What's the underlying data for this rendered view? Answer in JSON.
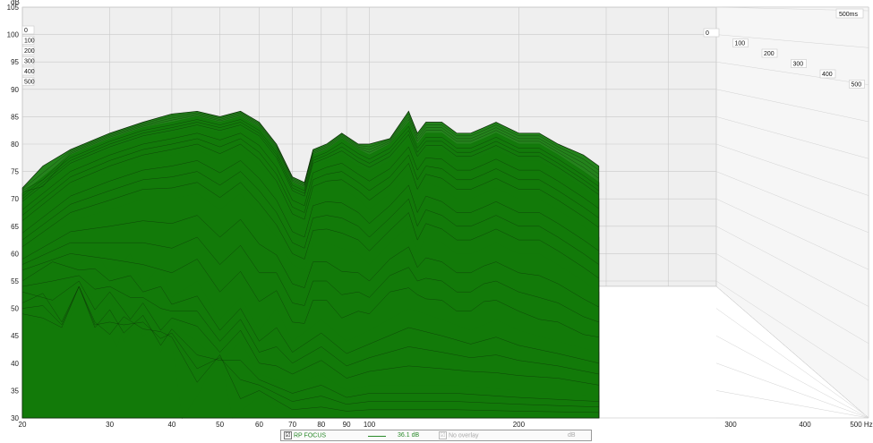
{
  "chart_data": {
    "type": "area",
    "chart_kind": "waterfall",
    "xlabel": "Hz",
    "ylabel": "dB",
    "x_scale": "log",
    "xlim": [
      20,
      500
    ],
    "ylim": [
      30,
      105
    ],
    "x_ticks": [
      "20",
      "30",
      "40",
      "50",
      "60",
      "70",
      "80",
      "90",
      "100",
      "200",
      "300",
      "400",
      "500 Hz"
    ],
    "x_tick_values": [
      20,
      30,
      40,
      50,
      60,
      70,
      80,
      90,
      100,
      200,
      300,
      400,
      500
    ],
    "y_ticks": [
      "30",
      "35",
      "40",
      "45",
      "50",
      "55",
      "60",
      "65",
      "70",
      "75",
      "80",
      "85",
      "90",
      "95",
      "100",
      "105"
    ],
    "y_tick_values": [
      30,
      35,
      40,
      45,
      50,
      55,
      60,
      65,
      70,
      75,
      80,
      85,
      90,
      95,
      100,
      105
    ],
    "time_ticks_left": [
      "0",
      "100",
      "200",
      "300",
      "400",
      "500"
    ],
    "time_ticks_right": [
      "0",
      "100",
      "200",
      "300",
      "400",
      "500"
    ],
    "time_range_label": "500ms",
    "grid": true,
    "fill_color": "#127a0a",
    "series": [
      {
        "time_ms": 0,
        "points": [
          [
            20,
            72
          ],
          [
            22,
            76
          ],
          [
            25,
            79
          ],
          [
            30,
            82
          ],
          [
            35,
            84
          ],
          [
            40,
            85.5
          ],
          [
            45,
            86
          ],
          [
            50,
            85
          ],
          [
            55,
            86
          ],
          [
            60,
            84
          ],
          [
            65,
            80
          ],
          [
            70,
            74
          ],
          [
            74,
            73
          ],
          [
            77,
            79
          ],
          [
            82,
            80
          ],
          [
            88,
            82
          ],
          [
            95,
            80
          ],
          [
            100,
            80
          ],
          [
            110,
            81
          ],
          [
            120,
            86
          ],
          [
            125,
            82
          ],
          [
            130,
            84
          ],
          [
            140,
            84
          ],
          [
            150,
            82
          ],
          [
            160,
            82
          ],
          [
            170,
            83
          ],
          [
            180,
            84
          ],
          [
            200,
            82
          ],
          [
            220,
            82
          ],
          [
            240,
            80
          ],
          [
            270,
            78
          ],
          [
            290,
            76
          ]
        ]
      },
      {
        "time_ms": 20,
        "points": [
          [
            20,
            71
          ],
          [
            25,
            78
          ],
          [
            30,
            81
          ],
          [
            35,
            83
          ],
          [
            40,
            84
          ],
          [
            45,
            85
          ],
          [
            50,
            84
          ],
          [
            55,
            85
          ],
          [
            60,
            83
          ],
          [
            65,
            79
          ],
          [
            70,
            73
          ],
          [
            74,
            72
          ],
          [
            77,
            78
          ],
          [
            82,
            79
          ],
          [
            88,
            81
          ],
          [
            95,
            79
          ],
          [
            100,
            78
          ],
          [
            110,
            80
          ],
          [
            120,
            84
          ],
          [
            125,
            80
          ],
          [
            130,
            82
          ],
          [
            140,
            82
          ],
          [
            150,
            80
          ],
          [
            160,
            80
          ],
          [
            170,
            81
          ],
          [
            180,
            82
          ],
          [
            200,
            80
          ],
          [
            220,
            80
          ],
          [
            240,
            78
          ],
          [
            270,
            75
          ],
          [
            290,
            73
          ]
        ]
      },
      {
        "time_ms": 50,
        "points": [
          [
            20,
            69
          ],
          [
            25,
            76
          ],
          [
            30,
            79
          ],
          [
            35,
            81
          ],
          [
            40,
            82
          ],
          [
            45,
            83
          ],
          [
            50,
            82
          ],
          [
            55,
            83
          ],
          [
            60,
            81
          ],
          [
            65,
            77
          ],
          [
            70,
            71
          ],
          [
            74,
            70
          ],
          [
            77,
            76
          ],
          [
            82,
            77
          ],
          [
            88,
            78
          ],
          [
            95,
            76
          ],
          [
            100,
            75
          ],
          [
            110,
            77
          ],
          [
            120,
            81
          ],
          [
            125,
            77
          ],
          [
            130,
            79
          ],
          [
            140,
            79
          ],
          [
            150,
            77
          ],
          [
            160,
            77
          ],
          [
            170,
            78
          ],
          [
            180,
            79
          ],
          [
            200,
            77
          ],
          [
            220,
            77
          ],
          [
            240,
            75
          ],
          [
            270,
            72
          ],
          [
            290,
            70
          ]
        ]
      },
      {
        "time_ms": 100,
        "points": [
          [
            20,
            65
          ],
          [
            25,
            72
          ],
          [
            30,
            75
          ],
          [
            35,
            77
          ],
          [
            40,
            78
          ],
          [
            45,
            79
          ],
          [
            50,
            77
          ],
          [
            55,
            79
          ],
          [
            60,
            76
          ],
          [
            65,
            72
          ],
          [
            70,
            66
          ],
          [
            74,
            65
          ],
          [
            77,
            71
          ],
          [
            82,
            72
          ],
          [
            88,
            72
          ],
          [
            95,
            70
          ],
          [
            100,
            68
          ],
          [
            110,
            71
          ],
          [
            120,
            75
          ],
          [
            125,
            70
          ],
          [
            130,
            73
          ],
          [
            140,
            72
          ],
          [
            150,
            70
          ],
          [
            160,
            70
          ],
          [
            170,
            71
          ],
          [
            180,
            72
          ],
          [
            200,
            70
          ],
          [
            220,
            70
          ],
          [
            240,
            68
          ],
          [
            270,
            65
          ],
          [
            290,
            63
          ]
        ]
      },
      {
        "time_ms": 200,
        "points": [
          [
            20,
            60
          ],
          [
            25,
            66
          ],
          [
            30,
            68
          ],
          [
            35,
            70
          ],
          [
            40,
            70
          ],
          [
            45,
            71
          ],
          [
            50,
            68
          ],
          [
            55,
            71
          ],
          [
            60,
            67
          ],
          [
            65,
            63
          ],
          [
            70,
            58
          ],
          [
            74,
            57
          ],
          [
            77,
            62
          ],
          [
            82,
            62
          ],
          [
            88,
            61
          ],
          [
            95,
            60
          ],
          [
            100,
            58
          ],
          [
            110,
            62
          ],
          [
            120,
            65
          ],
          [
            125,
            60
          ],
          [
            130,
            63
          ],
          [
            140,
            62
          ],
          [
            150,
            60
          ],
          [
            160,
            60
          ],
          [
            170,
            61
          ],
          [
            180,
            62
          ],
          [
            200,
            60
          ],
          [
            220,
            60
          ],
          [
            240,
            58
          ],
          [
            270,
            55
          ],
          [
            290,
            53
          ]
        ]
      },
      {
        "time_ms": 300,
        "points": [
          [
            20,
            56
          ],
          [
            23,
            62
          ],
          [
            26,
            58
          ],
          [
            28,
            61
          ],
          [
            30,
            56
          ],
          [
            33,
            60
          ],
          [
            35,
            54
          ],
          [
            38,
            58
          ],
          [
            40,
            52
          ],
          [
            45,
            55
          ],
          [
            50,
            48
          ],
          [
            55,
            52
          ],
          [
            60,
            46
          ],
          [
            65,
            50
          ],
          [
            70,
            44
          ],
          [
            80,
            48
          ],
          [
            90,
            44
          ],
          [
            100,
            46
          ],
          [
            120,
            50
          ],
          [
            140,
            48
          ],
          [
            160,
            46
          ],
          [
            180,
            48
          ],
          [
            200,
            46
          ],
          [
            240,
            44
          ],
          [
            290,
            42
          ]
        ]
      },
      {
        "time_ms": 400,
        "points": [
          [
            20,
            52
          ],
          [
            22,
            55
          ],
          [
            24,
            48
          ],
          [
            26,
            54
          ],
          [
            28,
            46
          ],
          [
            30,
            52
          ],
          [
            32,
            44
          ],
          [
            35,
            50
          ],
          [
            38,
            42
          ],
          [
            40,
            47
          ],
          [
            45,
            44
          ],
          [
            50,
            40
          ],
          [
            55,
            44
          ],
          [
            60,
            38
          ],
          [
            70,
            36
          ],
          [
            80,
            38
          ],
          [
            90,
            35
          ],
          [
            100,
            36
          ],
          [
            150,
            36
          ],
          [
            200,
            35
          ],
          [
            290,
            34
          ]
        ]
      },
      {
        "time_ms": 500,
        "points": [
          [
            20,
            48
          ],
          [
            24,
            46
          ],
          [
            27,
            54
          ],
          [
            29,
            48
          ],
          [
            31,
            43
          ],
          [
            33,
            50
          ],
          [
            35,
            45
          ],
          [
            38,
            47
          ],
          [
            40,
            44
          ],
          [
            42,
            30
          ],
          [
            45,
            34
          ],
          [
            50,
            42
          ],
          [
            53,
            30
          ],
          [
            60,
            34
          ],
          [
            70,
            30
          ],
          [
            100,
            30
          ],
          [
            290,
            30
          ]
        ]
      }
    ]
  },
  "legend": {
    "checkbox_mark": "☑",
    "no_overlay_mark": "☑",
    "measurement_name": "RP FOCUS",
    "line_color": "#2a8a2a",
    "level": "36.1 dB",
    "overlay_label": "No overlay",
    "unit": "dB"
  }
}
